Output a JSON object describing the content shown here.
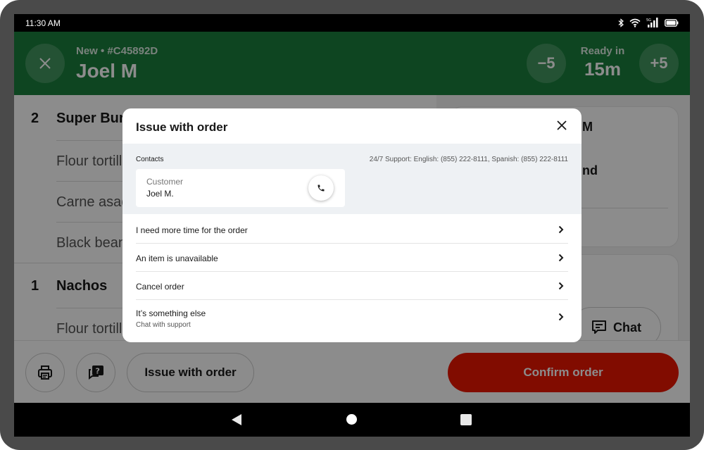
{
  "status_bar": {
    "time": "11:30 AM",
    "icons": [
      "bluetooth-icon",
      "wifi-icon",
      "signal-5g-icon",
      "battery-icon"
    ]
  },
  "header": {
    "subtitle": "New • #C45892D",
    "title": "Joel M",
    "decrease_label": "−5",
    "ready_label": "Ready in",
    "ready_value": "15m",
    "increase_label": "+5"
  },
  "order_items": [
    {
      "qty": "2",
      "name": "Super Burrito",
      "modifiers": [
        "Flour tortilla",
        "Carne asada",
        "Black beans"
      ]
    },
    {
      "qty": "1",
      "name": "Nachos",
      "modifiers": [
        "Flour tortilla"
      ]
    }
  ],
  "right_panel": {
    "card1_line1": "M",
    "card1_line2": "nd",
    "chat_label": "Chat"
  },
  "bottom_bar": {
    "issue_label": "Issue with order",
    "confirm_label": "Confirm order"
  },
  "modal": {
    "title": "Issue with order",
    "contacts_label": "Contacts",
    "support_text": "24/7 Support: English: (855) 222-8111, Spanish: (855) 222-8111",
    "contact": {
      "role": "Customer",
      "name": "Joel M."
    },
    "options": [
      {
        "label": "I need more time for the order",
        "sub": ""
      },
      {
        "label": "An item is unavailable",
        "sub": ""
      },
      {
        "label": "Cancel order",
        "sub": ""
      },
      {
        "label": "It’s something else",
        "sub": "Chat with support"
      }
    ]
  },
  "colors": {
    "header_green": "#1a7f3c",
    "confirm_red": "#eb1700",
    "contacts_bg": "#eef1f4"
  }
}
